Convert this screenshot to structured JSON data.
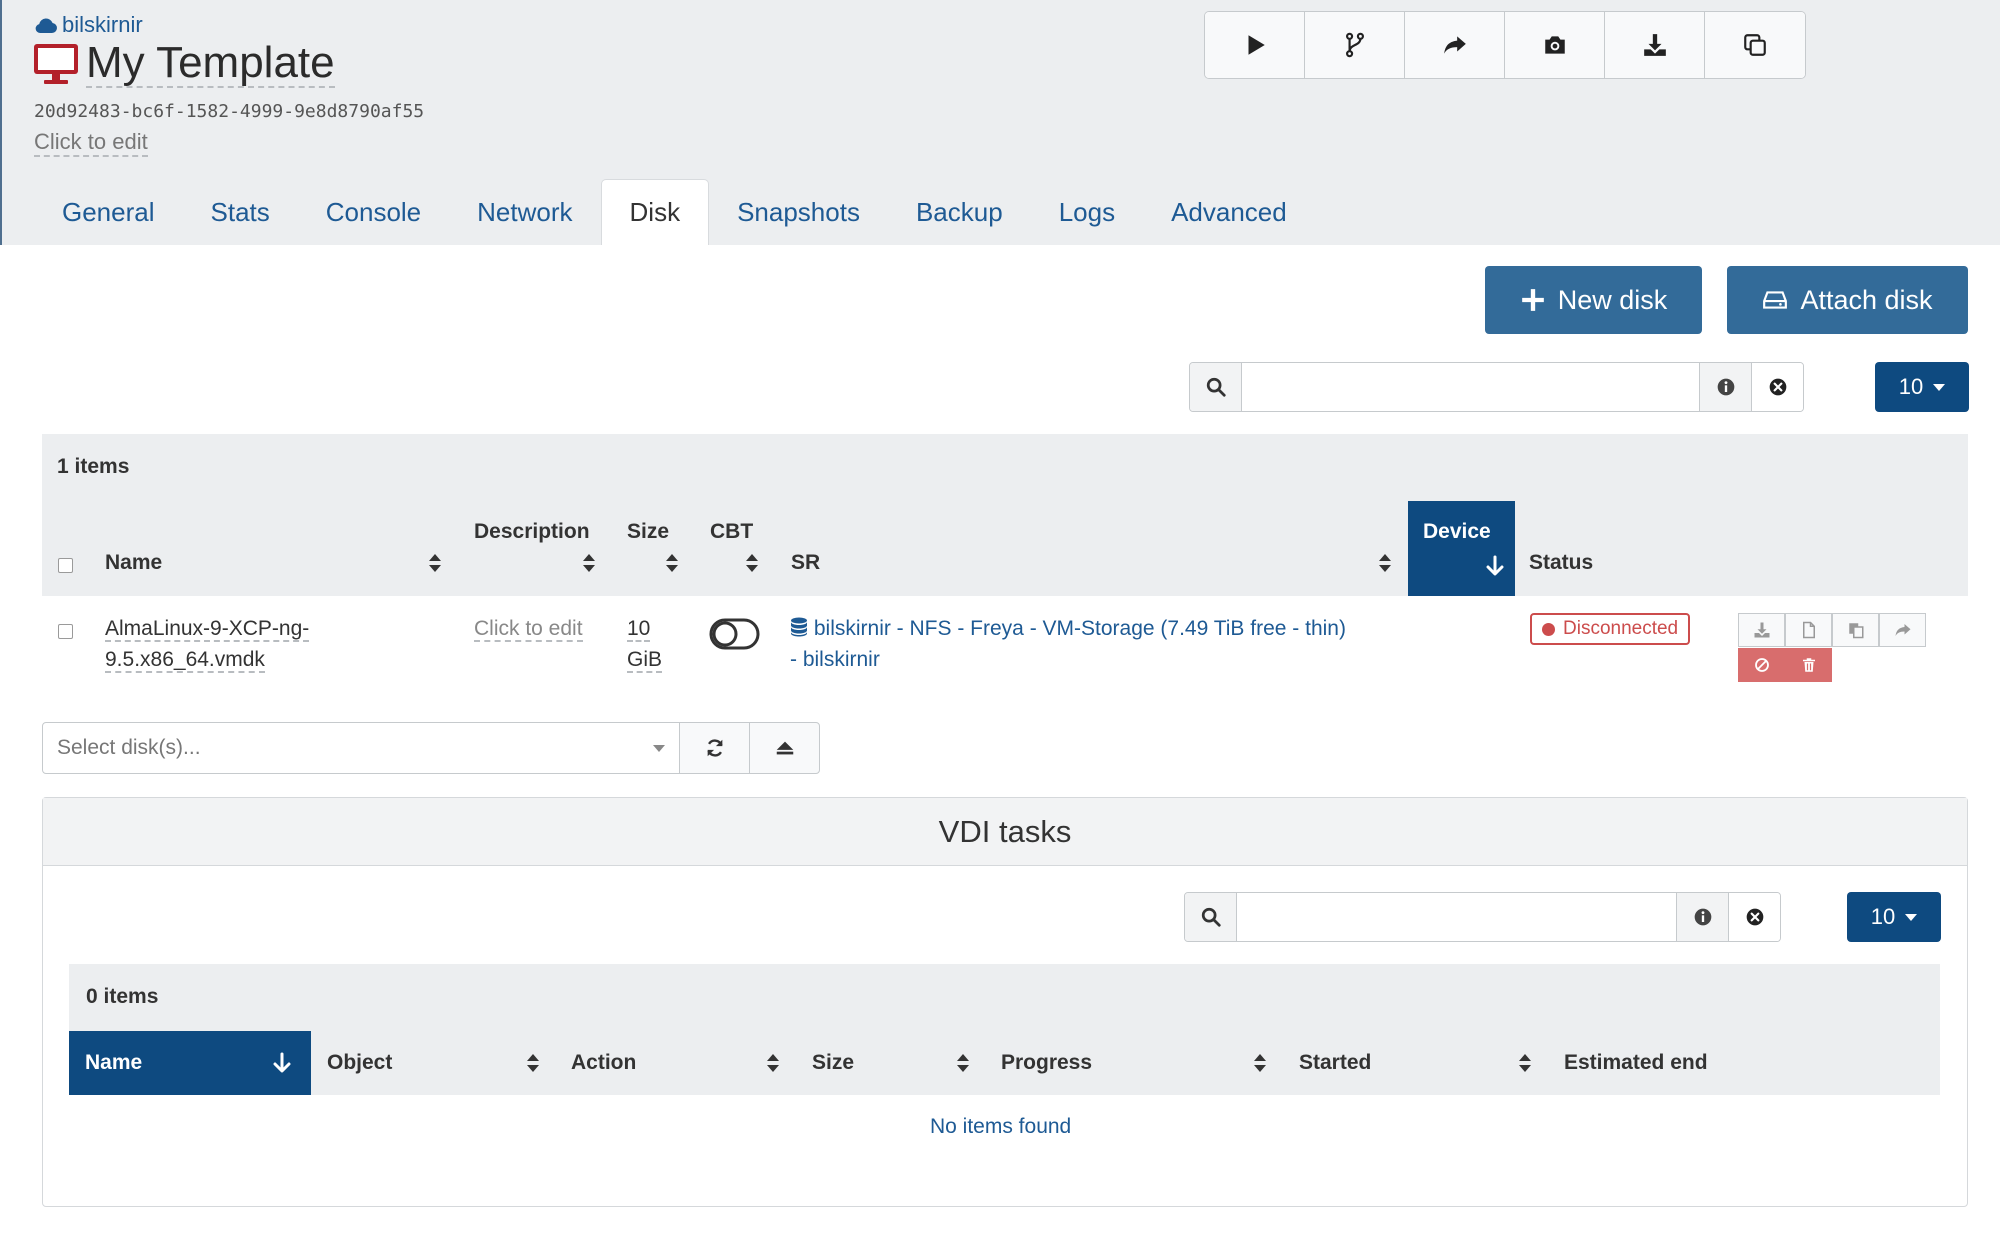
{
  "header": {
    "pool_name": "bilskirnir",
    "vm_title": "My Template",
    "uuid": "20d92483-bc6f-1582-4999-9e8d8790af55",
    "description_placeholder": "Click to edit"
  },
  "toolbar": {
    "buttons": [
      {
        "icon": "play-icon"
      },
      {
        "icon": "fork-icon"
      },
      {
        "icon": "share-icon"
      },
      {
        "icon": "camera-icon"
      },
      {
        "icon": "download-icon"
      },
      {
        "icon": "copy-icon"
      }
    ]
  },
  "tabs": [
    {
      "label": "General"
    },
    {
      "label": "Stats"
    },
    {
      "label": "Console"
    },
    {
      "label": "Network"
    },
    {
      "label": "Disk",
      "active": true
    },
    {
      "label": "Snapshots"
    },
    {
      "label": "Backup"
    },
    {
      "label": "Logs"
    },
    {
      "label": "Advanced"
    }
  ],
  "actions": {
    "new_disk": "New disk",
    "attach_disk": "Attach disk"
  },
  "disk_table": {
    "search_value": "",
    "page_size": "10",
    "items_count": "1 items",
    "columns": {
      "name": "Name",
      "description": "Description",
      "size": "Size",
      "cbt": "CBT",
      "sr": "SR",
      "device": "Device",
      "status": "Status"
    },
    "rows": [
      {
        "name_line1": "AlmaLinux-9-XCP-ng-",
        "name_line2": "9.5.x86_64.vmdk",
        "description": "Click to edit",
        "size_line1": "10",
        "size_line2": "GiB",
        "cbt_enabled": false,
        "sr_line1": "bilskirnir - NFS - Freya - VM-Storage (7.49 TiB free - thin)",
        "sr_line2": "- bilskirnir",
        "status": "Disconnected"
      }
    ]
  },
  "disk_select": {
    "placeholder": "Select disk(s)..."
  },
  "vdi_tasks": {
    "title": "VDI tasks",
    "search_value": "",
    "page_size": "10",
    "items_count": "0 items",
    "columns": {
      "name": "Name",
      "object": "Object",
      "action": "Action",
      "size": "Size",
      "progress": "Progress",
      "started": "Started",
      "estimated_end": "Estimated end"
    },
    "empty_text": "No items found"
  },
  "colors": {
    "primary": "#336b99",
    "dark_primary": "#0e4a80",
    "link": "#1e5a94",
    "danger": "#cc4c4c",
    "vm_icon": "#b3202a"
  }
}
